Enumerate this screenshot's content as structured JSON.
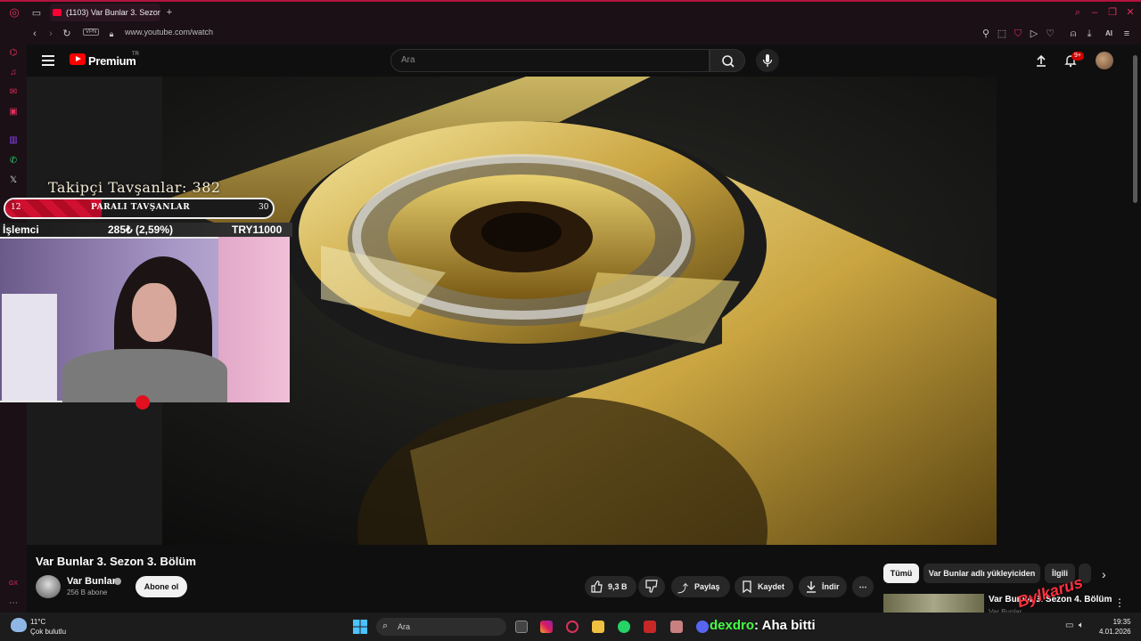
{
  "browser": {
    "tab_title": "(1103) Var Bunlar 3. Sezon",
    "new_tab": "+",
    "vpn_label": "VPN",
    "url": "www.youtube.com/watch",
    "ai_label": "AI"
  },
  "youtube": {
    "brand": "Premium",
    "brand_sup": "TR",
    "search_placeholder": "Ara",
    "notification_count": "9+"
  },
  "overlay": {
    "followers_label": "Takipçi Tavşanlar: 382",
    "progress_left": "12",
    "progress_label": "PARALI TAVŞANLAR",
    "progress_right": "30",
    "progress_fraction": 0.36,
    "ticker_name": "İşlemci",
    "ticker_change": "285₺ (2,59%)",
    "ticker_price": "TRY11000"
  },
  "video": {
    "title": "Var Bunlar 3. Sezon 3. Bölüm",
    "channel": "Var Bunlar",
    "subscribers": "256 B abone",
    "subscribe_label": "Abone ol",
    "likes": "9,3 B",
    "share_label": "Paylaş",
    "save_label": "Kaydet",
    "download_label": "İndir",
    "more_label": "⋯"
  },
  "chips": [
    {
      "label": "Tümü",
      "active": true
    },
    {
      "label": "Var Bunlar adlı yükleyiciden"
    },
    {
      "label": "İlgili"
    }
  ],
  "suggestion": {
    "title": "Var Bunlar 3. Sezon 4. Bölüm",
    "channel": "Var Bunlar"
  },
  "taskbar": {
    "weather_temp": "11°C",
    "weather_desc": "Çok bulutlu",
    "search_placeholder": "Ara",
    "chat_user": "dexdro",
    "chat_message": ": Aha bitti",
    "time": "19:35",
    "date": "4.01.2026",
    "watermark": "Bylkarus"
  },
  "colors": {
    "accent": "#b0143c",
    "youtube_red": "#ff0000",
    "progress_red": "#d01030"
  }
}
